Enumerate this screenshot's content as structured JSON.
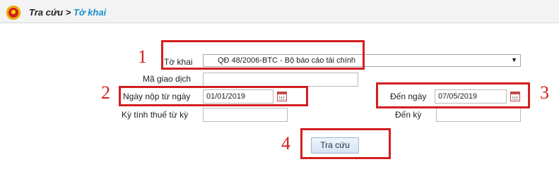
{
  "header": {
    "crumb_parent": "Tra cứu",
    "crumb_sep": ">",
    "crumb_current": "Tờ khai"
  },
  "form": {
    "to_khai_label": "Tờ khai",
    "to_khai_value": "QĐ 48/2006-BTC - Bộ báo cáo tài chính",
    "ma_giao_dich_label": "Mã giao dịch",
    "ma_giao_dich_value": "",
    "ngay_nop_tu_label": "Ngày nộp từ ngày",
    "ngay_nop_tu_value": "01/01/2019",
    "den_ngay_label": "Đến ngày",
    "den_ngay_value": "07/05/2019",
    "ky_tinh_thue_label": "Kỳ tính thuế từ kỳ",
    "ky_tinh_thue_value": "",
    "den_ky_label": "Đến kỳ",
    "den_ky_value": "",
    "search_button": "Tra cứu"
  },
  "annotations": {
    "n1": "1",
    "n2": "2",
    "n3": "3",
    "n4": "4"
  },
  "colors": {
    "annotation_red": "#d31f1f",
    "breadcrumb_blue": "#1a8fd0"
  },
  "icons": {
    "emblem": "national-emblem-icon",
    "calendar": "calendar-icon",
    "dropdown": "dropdown-arrow-icon"
  }
}
